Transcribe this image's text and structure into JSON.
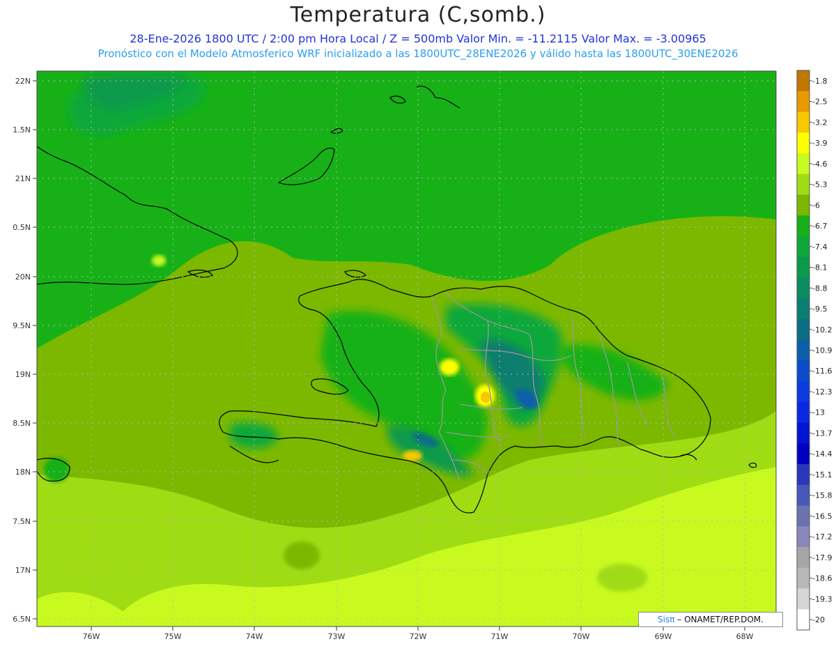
{
  "title": "Temperatura (C,somb.)",
  "subtitle_line1": "28-Ene-2026  1800 UTC / 2:00 pm Hora Local / Z = 500mb  Valor Min. = -11.2115  Valor Max. = -3.00965",
  "subtitle_line2": "Pronóstico con el Modelo Atmosferico WRF inicializado a las 1800UTC_28ENE2026 y válido hasta las  1800UTC_30ENE2026",
  "credit": {
    "logo": "Sisπ",
    "text": "– ONAMET/REP.DOM."
  },
  "map": {
    "lat_range": [
      16.4,
      22.1
    ],
    "lon_range": [
      -76.65,
      -67.6
    ],
    "lat_labels": [
      "22N",
      "1.5N",
      "21N",
      "0.5N",
      "20N",
      "9.5N",
      "19N",
      "8.5N",
      "18N",
      "7.5N",
      "17N",
      "6.5N"
    ],
    "lon_labels": [
      "76W",
      "75W",
      "74W",
      "73W",
      "72W",
      "71W",
      "70W",
      "69W",
      "68W"
    ],
    "grid": true
  },
  "legend": {
    "labels": [
      "-1.8",
      "-2.5",
      "-3.2",
      "-3.9",
      "-4.6",
      "-5.3",
      "-6",
      "-6.7",
      "-7.4",
      "-8.1",
      "-8.8",
      "-9.5",
      "-10.2",
      "-10.9",
      "-11.6",
      "-12.3",
      "-13",
      "-13.7",
      "-14.4",
      "-15.1",
      "-15.8",
      "-16.5",
      "-17.2",
      "-17.9",
      "-18.6",
      "-19.3",
      "-20"
    ],
    "colors": [
      "#c07800",
      "#e89a00",
      "#f8c800",
      "#ffff00",
      "#c8fa20",
      "#a0dc14",
      "#7cb800",
      "#17b117",
      "#0da83a",
      "#0a9a4c",
      "#0b8c60",
      "#0a7e70",
      "#0a6e84",
      "#0a5eaa",
      "#0a4ccc",
      "#0a3ae0",
      "#0a28e4",
      "#0014d4",
      "#0000c0",
      "#2838b8",
      "#4858b8",
      "#6a72b0",
      "#8a88ba",
      "#a6a6a6",
      "#b8b8b8",
      "#d6d6d6",
      "#ffffff"
    ]
  }
}
